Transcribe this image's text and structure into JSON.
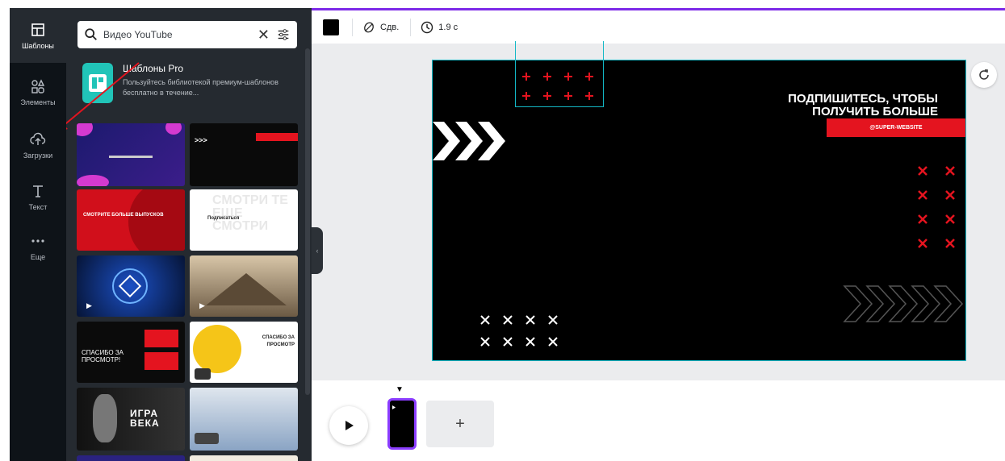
{
  "sidebar": {
    "items": [
      {
        "label": "Шаблоны",
        "icon": "templates-icon"
      },
      {
        "label": "Элементы",
        "icon": "elements-icon"
      },
      {
        "label": "Загрузки",
        "icon": "upload-icon"
      },
      {
        "label": "Текст",
        "icon": "text-icon"
      },
      {
        "label": "Еще",
        "icon": "more-icon"
      }
    ]
  },
  "panel": {
    "search_value": "Видео YouTube",
    "clear_label": "✕",
    "promo": {
      "title": "Шаблоны Pro",
      "desc": "Пользуйтесь библиотекой премиум-шаблонов бесплатно в течение..."
    },
    "thumbnails": {
      "t3_title": "СМОТРИТЕ БОЛЬШЕ ВЫПУСКОВ",
      "t4_title": "Подписаться",
      "t4_bg": "СМОТРИ ТЕ ЕЩЕ СМОТРИ",
      "t7_title": "СПАСИБО ЗА ПРОСМОТР!",
      "t8_title": "СПАСИБО ЗА ПРОСМОТР",
      "t9_title": "ИГРА ВЕКА"
    }
  },
  "toolbar": {
    "color": "#000000",
    "transparency_label": "Сдв.",
    "duration_label": "1.9 с"
  },
  "canvas": {
    "title_line1": "ПОДПИШИТЕСЬ, ЧТОБЫ",
    "title_line2": "ПОЛУЧИТЬ БОЛЬШЕ",
    "badge": "@SUPER-WEBSITE"
  },
  "timeline": {
    "add_label": "+"
  },
  "colors": {
    "accent": "#8b3dff",
    "red": "#e4141f",
    "teal": "#14b8c6"
  }
}
